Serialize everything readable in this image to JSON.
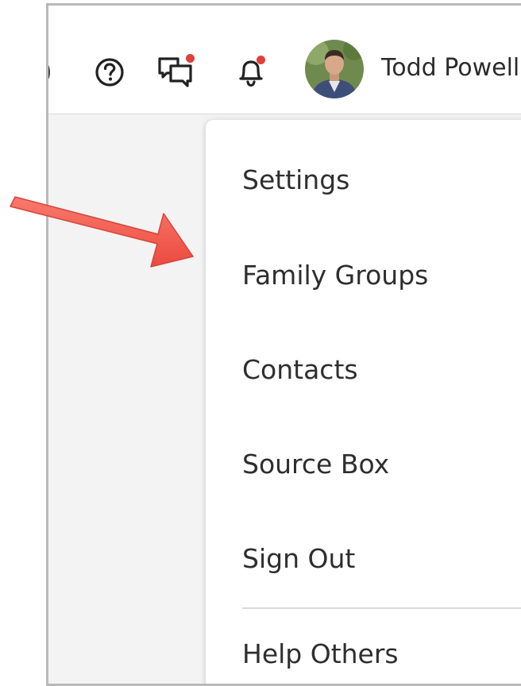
{
  "header": {
    "icons": [
      "help-icon",
      "messages-icon",
      "notifications-icon"
    ],
    "user_name": "Todd Powell"
  },
  "menu": {
    "items": [
      {
        "label": "Settings"
      },
      {
        "label": "Family Groups"
      },
      {
        "label": "Contacts"
      },
      {
        "label": "Source Box"
      },
      {
        "label": "Sign Out"
      },
      {
        "label": "Help Others"
      }
    ]
  },
  "colors": {
    "notification_dot": "#e0403a",
    "arrow_fill": "#f25c4f",
    "menu_text": "#2e2e2e"
  }
}
